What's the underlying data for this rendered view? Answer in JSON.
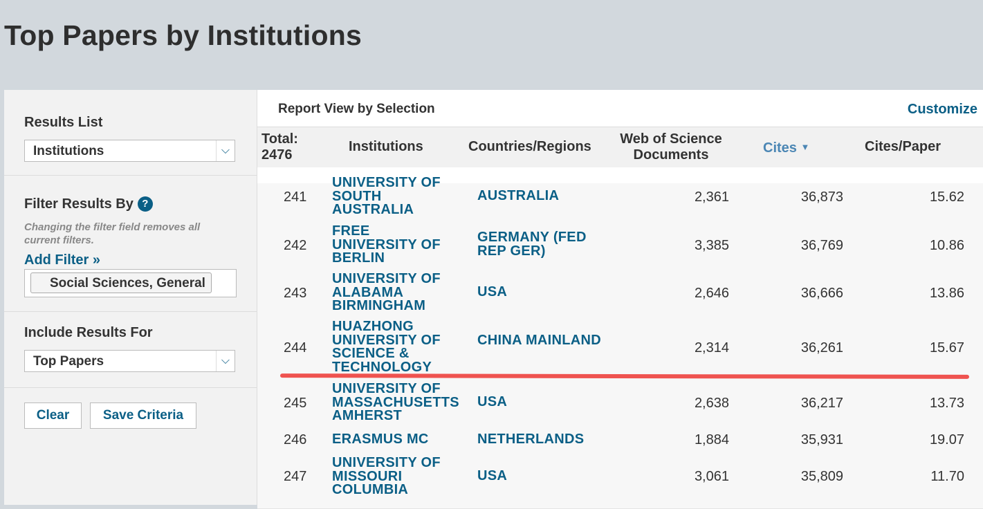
{
  "page": {
    "title": "Top Papers by Institutions"
  },
  "sidebar": {
    "results_list": {
      "label": "Results List",
      "selected": "Institutions"
    },
    "filter": {
      "label": "Filter Results By",
      "help": "?",
      "hint": "Changing the filter field removes all current filters.",
      "add_filter": "Add Filter »",
      "active_filter": "Social Sciences, General"
    },
    "include": {
      "label": "Include Results For",
      "selected": "Top Papers"
    },
    "buttons": {
      "clear": "Clear",
      "save": "Save Criteria"
    }
  },
  "report": {
    "title": "Report View by Selection",
    "customize": "Customize",
    "total_label": "Total:",
    "total_value": "2476",
    "columns": {
      "institutions": "Institutions",
      "countries": "Countries/Regions",
      "docs": "Web of Science Documents",
      "cites": "Cites",
      "cites_per_paper": "Cites/Paper"
    },
    "rows": [
      {
        "rank": "241",
        "institution": "UNIVERSITY OF SOUTH AUSTRALIA",
        "country": "AUSTRALIA",
        "docs": "2,361",
        "cites": "36,873",
        "cpp": "15.62"
      },
      {
        "rank": "242",
        "institution": "FREE UNIVERSITY OF BERLIN",
        "country": "GERMANY (FED REP GER)",
        "docs": "3,385",
        "cites": "36,769",
        "cpp": "10.86"
      },
      {
        "rank": "243",
        "institution": "UNIVERSITY OF ALABAMA BIRMINGHAM",
        "country": "USA",
        "docs": "2,646",
        "cites": "36,666",
        "cpp": "13.86"
      },
      {
        "rank": "244",
        "institution": "HUAZHONG UNIVERSITY OF SCIENCE & TECHNOLOGY",
        "country": "CHINA MAINLAND",
        "docs": "2,314",
        "cites": "36,261",
        "cpp": "15.67"
      },
      {
        "rank": "245",
        "institution": "UNIVERSITY OF MASSACHUSETTS AMHERST",
        "country": "USA",
        "docs": "2,638",
        "cites": "36,217",
        "cpp": "13.73"
      },
      {
        "rank": "246",
        "institution": "ERASMUS MC",
        "country": "NETHERLANDS",
        "docs": "1,884",
        "cites": "35,931",
        "cpp": "19.07"
      },
      {
        "rank": "247",
        "institution": "UNIVERSITY OF MISSOURI COLUMBIA",
        "country": "USA",
        "docs": "3,061",
        "cites": "35,809",
        "cpp": "11.70"
      }
    ]
  },
  "colors": {
    "link": "#0b5f86",
    "sort_header": "#4b86b4",
    "highlight": "#ef5350"
  }
}
